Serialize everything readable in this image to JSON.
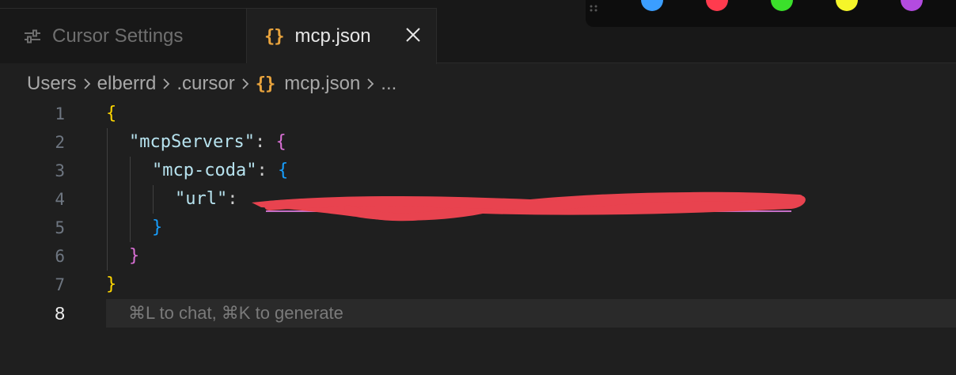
{
  "tabs": [
    {
      "label": "Cursor Settings",
      "icon": "sliders-icon",
      "active": false
    },
    {
      "label": "mcp.json",
      "icon": "json-braces-icon",
      "active": true,
      "close_icon": "close-icon"
    }
  ],
  "toolbar_colors": [
    "#3b9eff",
    "#ff3b4e",
    "#3be02b",
    "#f5f52a",
    "#b34be0"
  ],
  "breadcrumb": {
    "items": [
      "Users",
      "elberrd",
      ".cursor",
      "mcp.json",
      "..."
    ],
    "file_icon": "json-braces-icon"
  },
  "editor": {
    "line_numbers": [
      "1",
      "2",
      "3",
      "4",
      "5",
      "6",
      "7",
      "8"
    ],
    "current_line": "8",
    "lines": {
      "l1_brace": "{",
      "l2_key": "\"mcpServers\"",
      "l2_colon": ": ",
      "l2_brace": "{",
      "l3_key": "\"mcp-coda\"",
      "l3_colon": ": ",
      "l3_brace": "{",
      "l4_key": "\"url\"",
      "l4_colon": ": ",
      "l5_brace": "}",
      "l6_brace": "}",
      "l7_brace": "}"
    },
    "hint": "⌘L to chat, ⌘K to generate"
  }
}
